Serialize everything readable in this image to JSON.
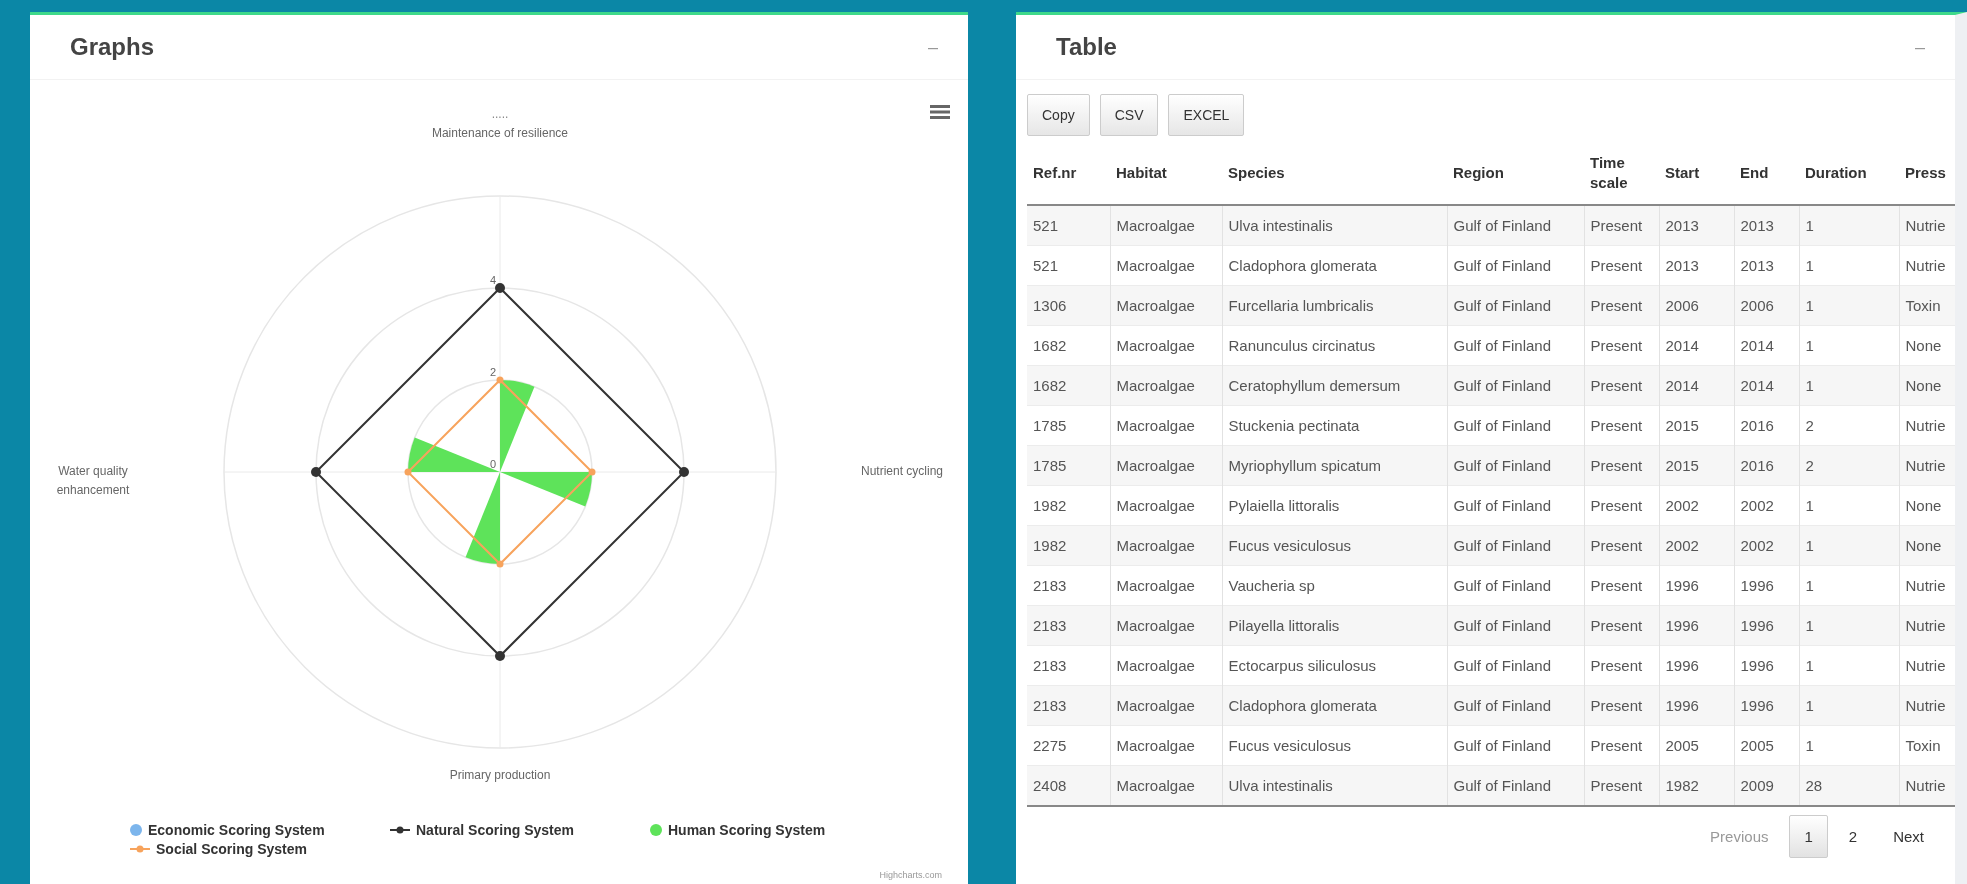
{
  "graphs_panel": {
    "title": "Graphs",
    "collapse": "–",
    "radar_chart": {
      "title": ".....",
      "axis_labels": [
        "Maintenance of resilience",
        "Nutrient cycling",
        "Primary production",
        "Water quality enhancement"
      ],
      "tick_labels": [
        "4",
        "2",
        "0"
      ],
      "legend": [
        {
          "name": "Economic Scoring System",
          "color": "#7cb5ec",
          "kind": "dot"
        },
        {
          "name": "Natural Scoring System",
          "color": "#333333",
          "kind": "line"
        },
        {
          "name": "Human Scoring System",
          "color": "#5ee35a",
          "kind": "dot"
        },
        {
          "name": "Social Scoring System",
          "color": "#f7a35c",
          "kind": "line"
        }
      ]
    },
    "credit": "Highcharts.com"
  },
  "table_panel": {
    "title": "Table",
    "collapse": "–",
    "buttons": [
      "Copy",
      "CSV",
      "EXCEL"
    ],
    "columns": [
      "Ref.nr",
      "Habitat",
      "Species",
      "Region",
      "Time scale",
      "Start",
      "End",
      "Duration",
      "Press"
    ],
    "rows": [
      [
        "521",
        "Macroalgae",
        "Ulva intestinalis",
        "Gulf of Finland",
        "Present",
        "2013",
        "2013",
        "1",
        "Nutrie"
      ],
      [
        "521",
        "Macroalgae",
        "Cladophora glomerata",
        "Gulf of Finland",
        "Present",
        "2013",
        "2013",
        "1",
        "Nutrie"
      ],
      [
        "1306",
        "Macroalgae",
        "Furcellaria lumbricalis",
        "Gulf of Finland",
        "Present",
        "2006",
        "2006",
        "1",
        "Toxin"
      ],
      [
        "1682",
        "Macroalgae",
        "Ranunculus circinatus",
        "Gulf of Finland",
        "Present",
        "2014",
        "2014",
        "1",
        "None"
      ],
      [
        "1682",
        "Macroalgae",
        "Ceratophyllum demersum",
        "Gulf of Finland",
        "Present",
        "2014",
        "2014",
        "1",
        "None"
      ],
      [
        "1785",
        "Macroalgae",
        "Stuckenia pectinata",
        "Gulf of Finland",
        "Present",
        "2015",
        "2016",
        "2",
        "Nutrie"
      ],
      [
        "1785",
        "Macroalgae",
        "Myriophyllum spicatum",
        "Gulf of Finland",
        "Present",
        "2015",
        "2016",
        "2",
        "Nutrie"
      ],
      [
        "1982",
        "Macroalgae",
        "Pylaiella littoralis",
        "Gulf of Finland",
        "Present",
        "2002",
        "2002",
        "1",
        "None"
      ],
      [
        "1982",
        "Macroalgae",
        "Fucus vesiculosus",
        "Gulf of Finland",
        "Present",
        "2002",
        "2002",
        "1",
        "None"
      ],
      [
        "2183",
        "Macroalgae",
        "Vaucheria sp",
        "Gulf of Finland",
        "Present",
        "1996",
        "1996",
        "1",
        "Nutrie"
      ],
      [
        "2183",
        "Macroalgae",
        "Pilayella littoralis",
        "Gulf of Finland",
        "Present",
        "1996",
        "1996",
        "1",
        "Nutrie"
      ],
      [
        "2183",
        "Macroalgae",
        "Ectocarpus siliculosus",
        "Gulf of Finland",
        "Present",
        "1996",
        "1996",
        "1",
        "Nutrie"
      ],
      [
        "2183",
        "Macroalgae",
        "Cladophora glomerata",
        "Gulf of Finland",
        "Present",
        "1996",
        "1996",
        "1",
        "Nutrie"
      ],
      [
        "2275",
        "Macroalgae",
        "Fucus vesiculosus",
        "Gulf of Finland",
        "Present",
        "2005",
        "2005",
        "1",
        "Toxin"
      ],
      [
        "2408",
        "Macroalgae",
        "Ulva intestinalis",
        "Gulf of Finland",
        "Present",
        "1982",
        "2009",
        "28",
        "Nutrie"
      ]
    ],
    "pagination": [
      {
        "label": "Previous",
        "selected": false,
        "disabled": true
      },
      {
        "label": "1",
        "selected": true,
        "disabled": false
      },
      {
        "label": "2",
        "selected": false,
        "disabled": false
      },
      {
        "label": "Next",
        "selected": false,
        "disabled": false
      }
    ]
  }
}
